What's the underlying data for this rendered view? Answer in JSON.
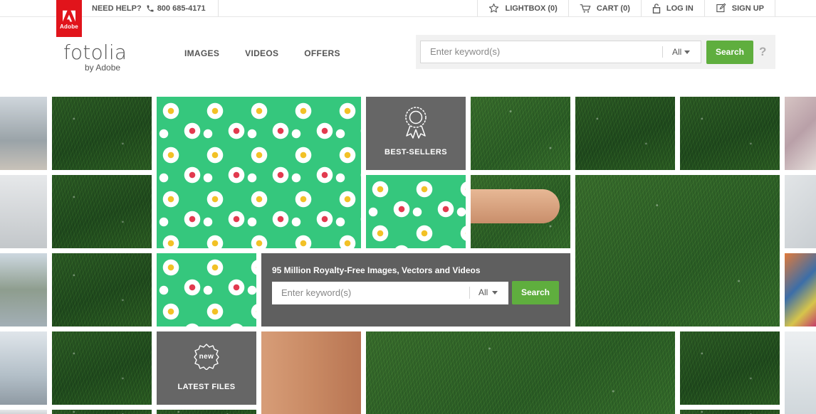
{
  "brand": {
    "adobe_label": "Adobe",
    "name": "fotolia",
    "by": "by Adobe"
  },
  "topbar": {
    "help_label": "NEED HELP?",
    "phone": "800 685-4171",
    "items": [
      {
        "label": "LIGHTBOX (0)",
        "icon": "star-icon"
      },
      {
        "label": "CART (0)",
        "icon": "cart-icon"
      },
      {
        "label": "LOG IN",
        "icon": "lock-icon"
      },
      {
        "label": "SIGN UP",
        "icon": "edit-icon"
      }
    ]
  },
  "nav": {
    "items": [
      "IMAGES",
      "VIDEOS",
      "OFFERS"
    ]
  },
  "header_search": {
    "placeholder": "Enter keyword(s)",
    "filter": "All",
    "button": "Search",
    "help": "?"
  },
  "hero": {
    "bestsellers_label": "BEST-SELLERS",
    "latest_label": "LATEST FILES",
    "new_badge": "new",
    "search_title": "95 Million Royalty-Free Images, Vectors and Videos",
    "search_placeholder": "Enter keyword(s)",
    "search_filter": "All",
    "search_button": "Search"
  },
  "colors": {
    "adobe_red": "#e1141b",
    "search_green": "#5fae3e",
    "tile_gray": "#666666"
  }
}
